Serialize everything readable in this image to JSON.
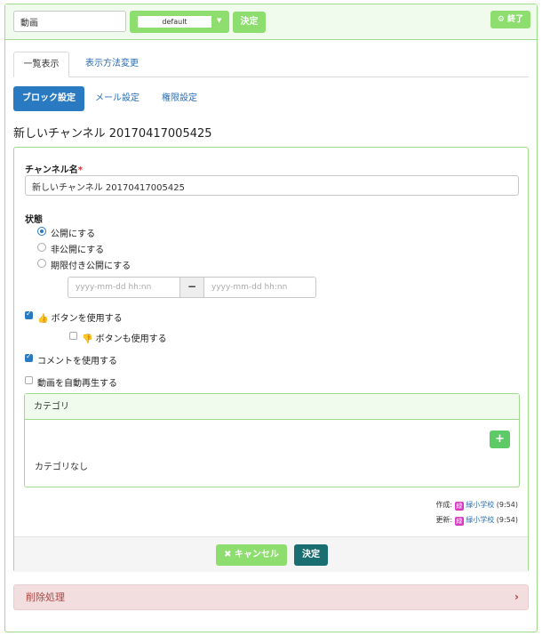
{
  "header": {
    "title_value": "動画",
    "frame_select": "default",
    "decide_label": "決定",
    "end_label": "⚙ 終了"
  },
  "tabs": [
    {
      "label": "一覧表示",
      "active": true
    },
    {
      "label": "表示方法変更",
      "active": false
    }
  ],
  "pills": [
    {
      "label": "ブロック設定",
      "active": true
    },
    {
      "label": "メール設定",
      "active": false
    },
    {
      "label": "権限設定",
      "active": false
    }
  ],
  "block_title": "新しいチャンネル 20170417005425",
  "form": {
    "channel_name_label": "チャンネル名",
    "required_mark": "*",
    "channel_name_value": "新しいチャンネル 20170417005425",
    "status_label": "状態",
    "status_options": [
      {
        "label": "公開にする",
        "selected": true
      },
      {
        "label": "非公開にする",
        "selected": false
      },
      {
        "label": "期限付き公開にする",
        "selected": false
      }
    ],
    "date_from_placeholder": "yyyy-mm-dd hh:nn",
    "date_sep": "−",
    "date_to_placeholder": "yyyy-mm-dd hh:nn",
    "like_label": "👍 ボタンを使用する",
    "like_checked": true,
    "unlike_label": "👎 ボタンも使用する",
    "unlike_checked": false,
    "comment_label": "コメントを使用する",
    "comment_checked": true,
    "autoplay_label": "動画を自動再生する",
    "autoplay_checked": false
  },
  "category": {
    "title": "カテゴリ",
    "add_label": "+",
    "empty_text": "カテゴリなし"
  },
  "meta": {
    "created_prefix": "作成:",
    "updated_prefix": "更新:",
    "badge": "緑",
    "user": "緑小学校",
    "created_time": "(9:54)",
    "updated_time": "(9:54)"
  },
  "footer": {
    "cancel_label": "✖ キャンセル",
    "decide_label": "決定"
  },
  "delete": {
    "label": "削除処理",
    "chevron": "›"
  },
  "colors": {
    "accent_green": "#8ddd6f",
    "primary_blue": "#2a7ac2",
    "teal": "#1a6e72",
    "danger_bg": "#f2dede"
  }
}
